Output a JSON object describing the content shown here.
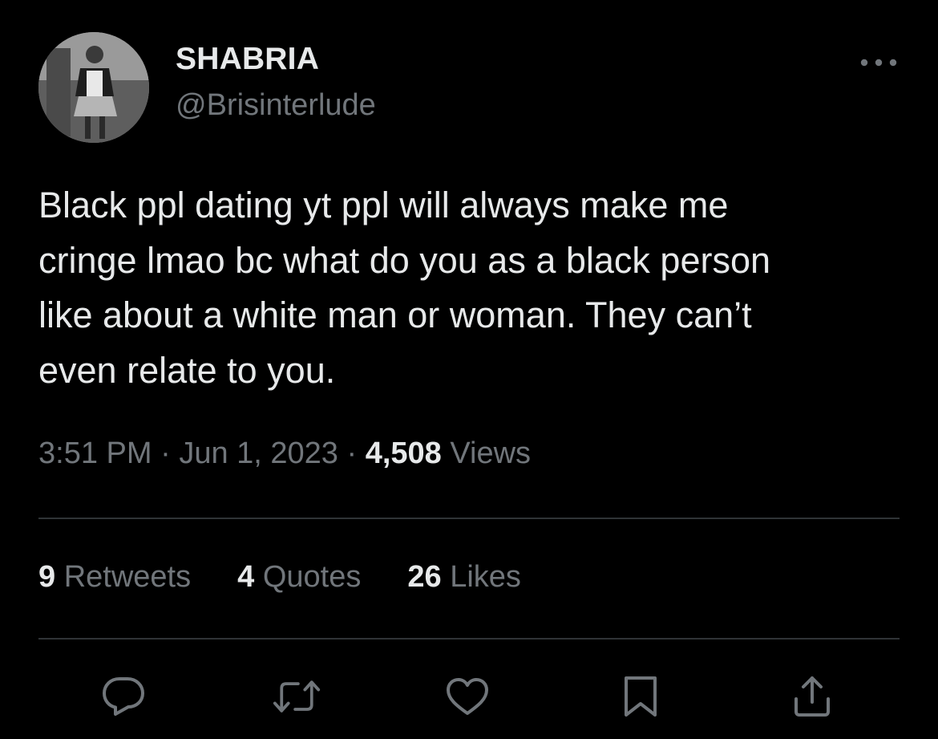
{
  "author": {
    "display_name": "SHABRIA",
    "handle": "@Brisinterlude",
    "avatar_icon": "user-avatar-photo"
  },
  "menu": {
    "icon": "more-horizontal-icon"
  },
  "tweet": {
    "text": "Black ppl dating yt ppl will always make me\ncringe lmao bc what do you as a black person\nlike about a white man or woman. They can’t\neven relate to you."
  },
  "meta": {
    "time": "3:51 PM",
    "separator": "·",
    "date": "Jun 1, 2023",
    "views_count": "4,508",
    "views_label": "Views"
  },
  "stats": {
    "retweets_count": "9",
    "retweets_label": "Retweets",
    "quotes_count": "4",
    "quotes_label": "Quotes",
    "likes_count": "26",
    "likes_label": "Likes"
  },
  "actions": [
    {
      "icon": "reply-icon"
    },
    {
      "icon": "retweet-icon"
    },
    {
      "icon": "like-icon"
    },
    {
      "icon": "bookmark-icon"
    },
    {
      "icon": "share-icon"
    }
  ],
  "colors": {
    "background": "#000000",
    "primary_text": "#e7e9ea",
    "secondary_text": "#71767b",
    "divider": "#2f3336",
    "icon": "#71767b"
  }
}
